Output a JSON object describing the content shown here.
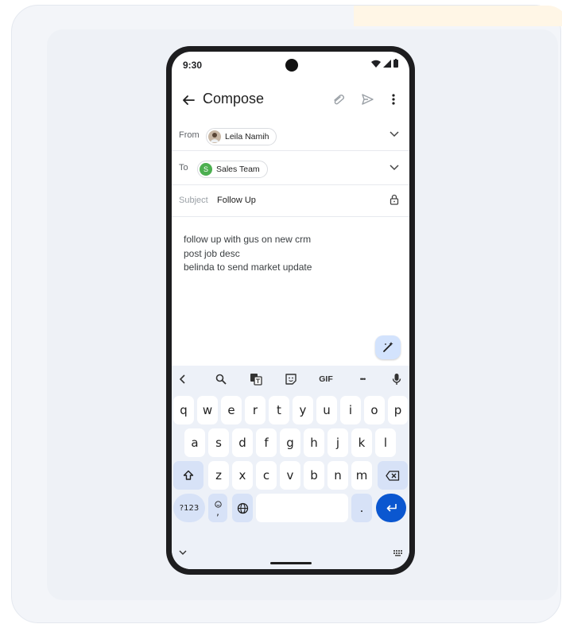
{
  "status_bar": {
    "time": "9:30"
  },
  "app_bar": {
    "title": "Compose"
  },
  "from": {
    "label": "From",
    "name": "Leila Namih"
  },
  "to": {
    "label": "To",
    "initial": "S",
    "name": "Sales Team"
  },
  "subject": {
    "label": "Subject",
    "value": "Follow Up"
  },
  "body_lines": [
    "follow up with gus on new crm",
    "post job desc",
    "belinda to send market update"
  ],
  "keyboard": {
    "toolbar": {
      "gif": "GIF",
      "more": "•••"
    },
    "row1": [
      "q",
      "w",
      "e",
      "r",
      "t",
      "y",
      "u",
      "i",
      "o",
      "p"
    ],
    "row2": [
      "a",
      "s",
      "d",
      "f",
      "g",
      "h",
      "j",
      "k",
      "l"
    ],
    "row3": [
      "z",
      "x",
      "c",
      "v",
      "b",
      "n",
      "m"
    ],
    "symbols_key": "?123",
    "comma_key": ",",
    "period_key": "."
  },
  "colors": {
    "accent": "#0b57d0",
    "fab": "#d3e3fd",
    "keyboard_bg": "#edf1f8",
    "sales_team_avatar": "#4caf50"
  },
  "icons": [
    "back-arrow-icon",
    "attach-icon",
    "send-icon",
    "more-vert-icon",
    "chevron-down-icon",
    "lock-icon",
    "magic-pen-icon",
    "search-icon",
    "translate-icon",
    "sticker-icon",
    "mic-icon",
    "shift-icon",
    "backspace-icon",
    "emoji-icon",
    "globe-icon",
    "enter-icon",
    "keyboard-grid-icon"
  ]
}
